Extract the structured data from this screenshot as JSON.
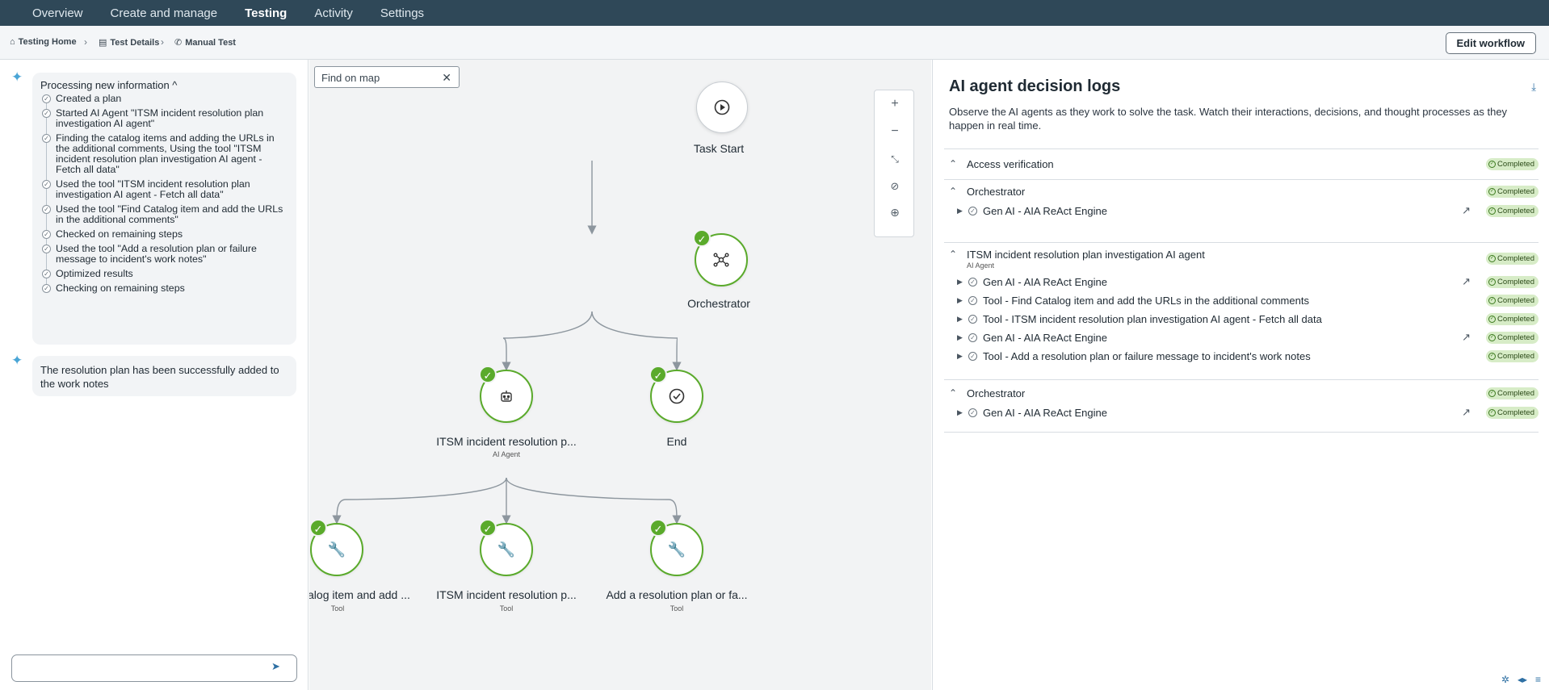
{
  "nav": {
    "items": [
      "Overview",
      "Create and manage",
      "Testing",
      "Activity",
      "Settings"
    ],
    "active": "Testing"
  },
  "breadcrumb": {
    "home": "Testing Home",
    "details": "Test Details",
    "current": "Manual Test"
  },
  "header": {
    "edit_button": "Edit workflow"
  },
  "chat": {
    "processing_title": "Processing new information ^",
    "steps": [
      "Created a plan",
      "Started AI Agent \"ITSM incident resolution plan investigation AI agent\"",
      "Finding the catalog items and adding the URLs in the additional comments, Using the tool \"ITSM incident resolution plan investigation AI agent - Fetch all data\"",
      "Used the tool \"ITSM incident resolution plan investigation AI agent - Fetch all data\"",
      "Used the tool \"Find Catalog item and add the URLs in the additional comments\"",
      "Checked on remaining steps",
      "Used the tool \"Add a resolution plan or failure message to incident's work notes\"",
      "Optimized results",
      "Checking on remaining steps"
    ],
    "result": "The resolution plan has been successfully added to the work notes",
    "input_placeholder": ""
  },
  "map": {
    "search_placeholder": "Find on map",
    "nodes": {
      "start": "Task Start",
      "orchestrator": "Orchestrator",
      "agent": "ITSM incident resolution p...",
      "agent_sub": "AI Agent",
      "end": "End",
      "tool1": "Find Catalog item and add ...",
      "tool2": "ITSM incident resolution p...",
      "tool3": "Add a resolution plan or fa...",
      "tool_sub": "Tool"
    }
  },
  "logs": {
    "title": "AI agent decision logs",
    "description": "Observe the AI agents as they work to solve the task. Watch their interactions, decisions, and thought processes as they happen in real time.",
    "status": "Completed",
    "sections": {
      "access": "Access verification",
      "orch1": "Orchestrator",
      "orch1_child": "Gen AI - AIA ReAct Engine",
      "agent": "ITSM incident resolution plan investigation AI agent",
      "agent_sub": "AI Agent",
      "agent_children": [
        "Gen AI - AIA ReAct Engine",
        "Tool - Find Catalog item and add the URLs in the additional comments",
        "Tool - ITSM incident resolution plan investigation AI agent - Fetch all data",
        "Gen AI - AIA ReAct Engine",
        "Tool - Add a resolution plan or failure message to incident's work notes"
      ],
      "orch2": "Orchestrator",
      "orch2_child": "Gen AI - AIA ReAct Engine"
    }
  },
  "colors": {
    "nav_bg": "#2f4858",
    "success": "#5aaa2b",
    "pill_bg": "#d7ecc7",
    "accent": "#2d6fa3"
  }
}
